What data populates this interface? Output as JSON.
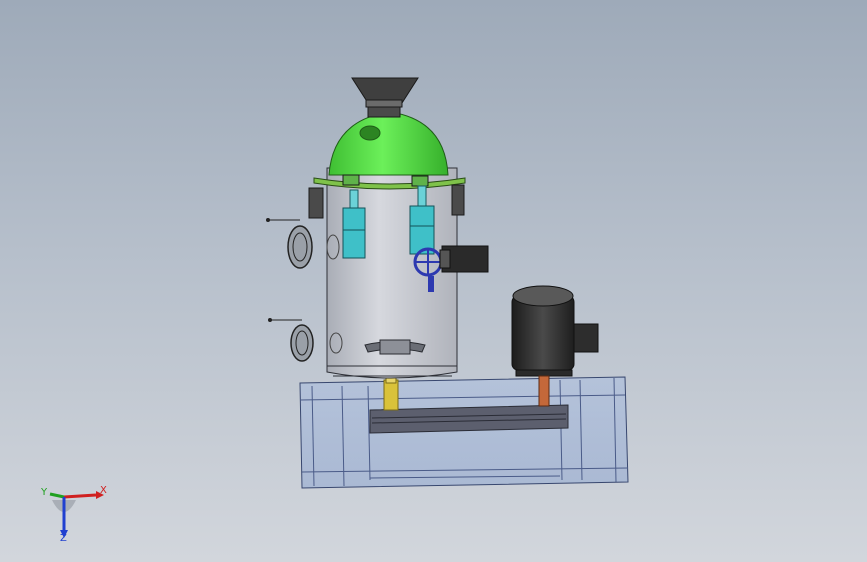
{
  "viewport": {
    "background_top": "#9eaab9",
    "background_bottom": "#d2d6dc"
  },
  "model": {
    "hopper_color": "#3f3f3f",
    "dome_color": "#59e246",
    "vessel_color": "#c9ccd3",
    "cylinder_color": "#3fc0c8",
    "valve_handwheel_color": "#2d39b0",
    "motor_color": "#2a2a2a",
    "shaft_color": "#d9c23a",
    "frame_color": "#7aa6d8"
  },
  "triad": {
    "x_label": "X",
    "y_label": "Y",
    "z_label": "Z",
    "x_color": "#d02020",
    "y_color": "#20a020",
    "z_color": "#2040d0"
  }
}
